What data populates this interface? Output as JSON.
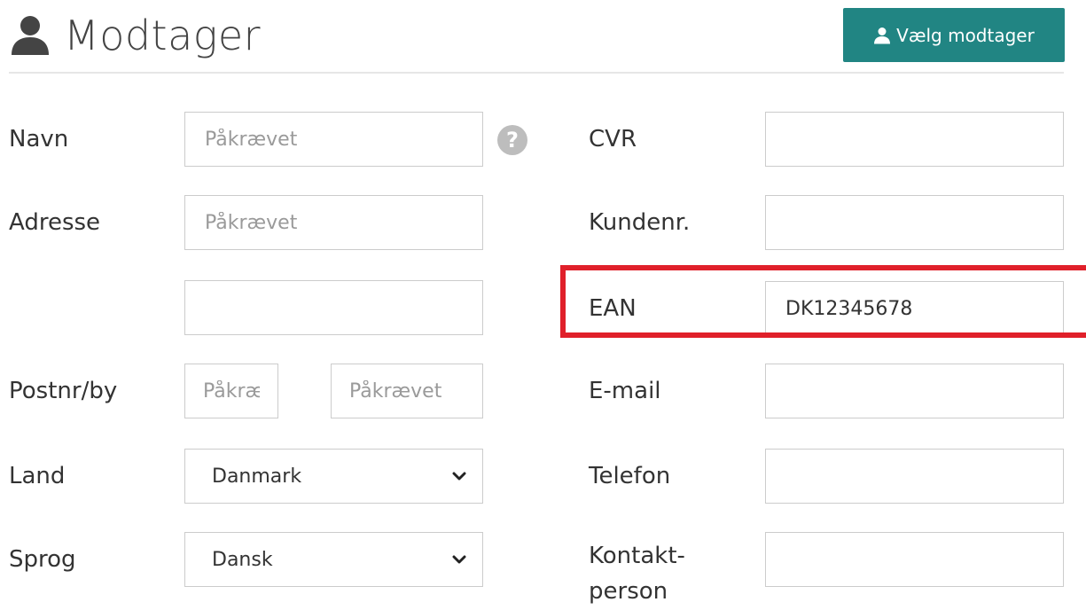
{
  "header": {
    "title": "Modtager",
    "icon": "user-icon",
    "pick_button_label": "Vælg modtager",
    "pick_button_icon": "user-icon",
    "accent_color": "#218583"
  },
  "form": {
    "left": {
      "name_label": "Navn",
      "name_placeholder": "Påkrævet",
      "address_label": "Adresse",
      "address_placeholder": "Påkrævet",
      "address2_placeholder": "",
      "postal_label": "Postnr/by",
      "postal_code_placeholder": "Påkrævet",
      "city_placeholder": "Påkrævet",
      "country_label": "Land",
      "country_value": "Danmark",
      "language_label": "Sprog",
      "language_value": "Dansk"
    },
    "right": {
      "cvr_label": "CVR",
      "cvr_value": "",
      "customer_no_label": "Kundenr.",
      "customer_no_value": "",
      "ean_label": "EAN",
      "ean_value": "DK12345678",
      "email_label": "E-mail",
      "email_value": "",
      "phone_label": "Telefon",
      "phone_value": "",
      "contact_label_line1": "Kontakt-",
      "contact_label_line2": "person",
      "contact_value": ""
    },
    "help_icon": "question-icon",
    "highlight_color": "#e0202a"
  }
}
